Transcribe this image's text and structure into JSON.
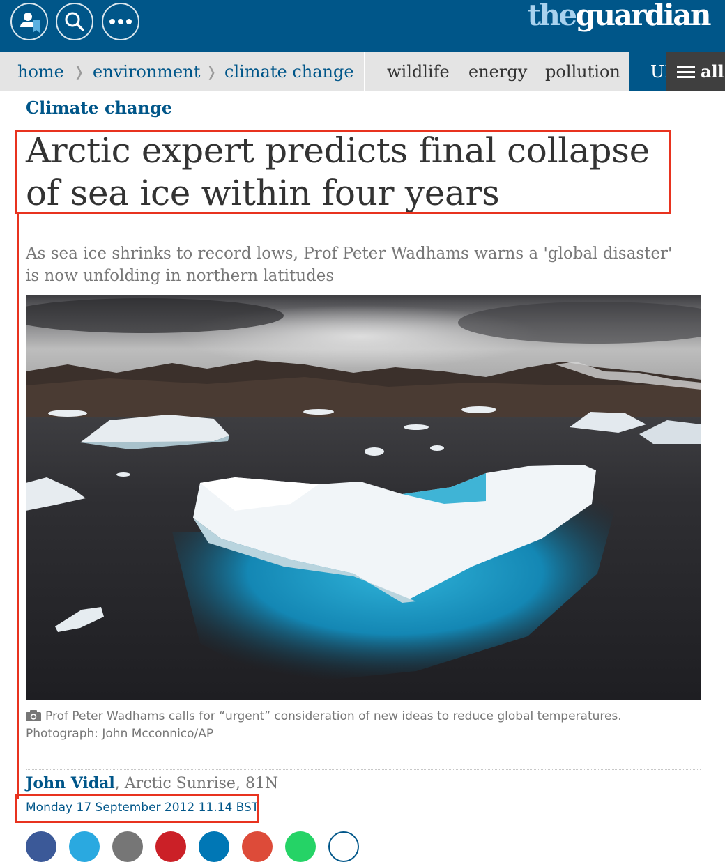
{
  "brand": {
    "the": "the",
    "guardian": "guardian"
  },
  "topbar": {
    "icons": [
      "profile-bookmark-icon",
      "search-icon",
      "more-dots-icon"
    ]
  },
  "nav": {
    "breadcrumb": [
      {
        "label": "home"
      },
      {
        "label": "environment"
      },
      {
        "label": "climate change"
      }
    ],
    "links": [
      "wildlife",
      "energy",
      "pollution"
    ],
    "edition": "UK",
    "all_label": "all"
  },
  "article": {
    "section": "Climate change",
    "headline": "Arctic expert predicts final collapse of sea ice within four years",
    "standfirst": "As sea ice shrinks to record lows, Prof Peter Wadhams warns a 'global disaster' is now unfolding in northern latitudes",
    "caption": "Prof Peter Wadhams calls for “urgent” consideration of new ideas to reduce global temperatures. Photograph: John Mcconnico/AP",
    "author": "John Vidal",
    "location": ", Arctic Sunrise, 81N",
    "date": "Monday 17 September 2012 11.14 BST"
  },
  "colors": {
    "brand_blue": "#005689",
    "brand_light_blue": "#a9d2ee",
    "nav_grey": "#e4e4e4",
    "all_dark": "#3f3f3f",
    "highlight_red": "#e8331f"
  },
  "share_buttons": [
    "facebook",
    "twitter",
    "email",
    "pinterest",
    "linkedin",
    "google-plus",
    "whatsapp",
    "messenger"
  ]
}
